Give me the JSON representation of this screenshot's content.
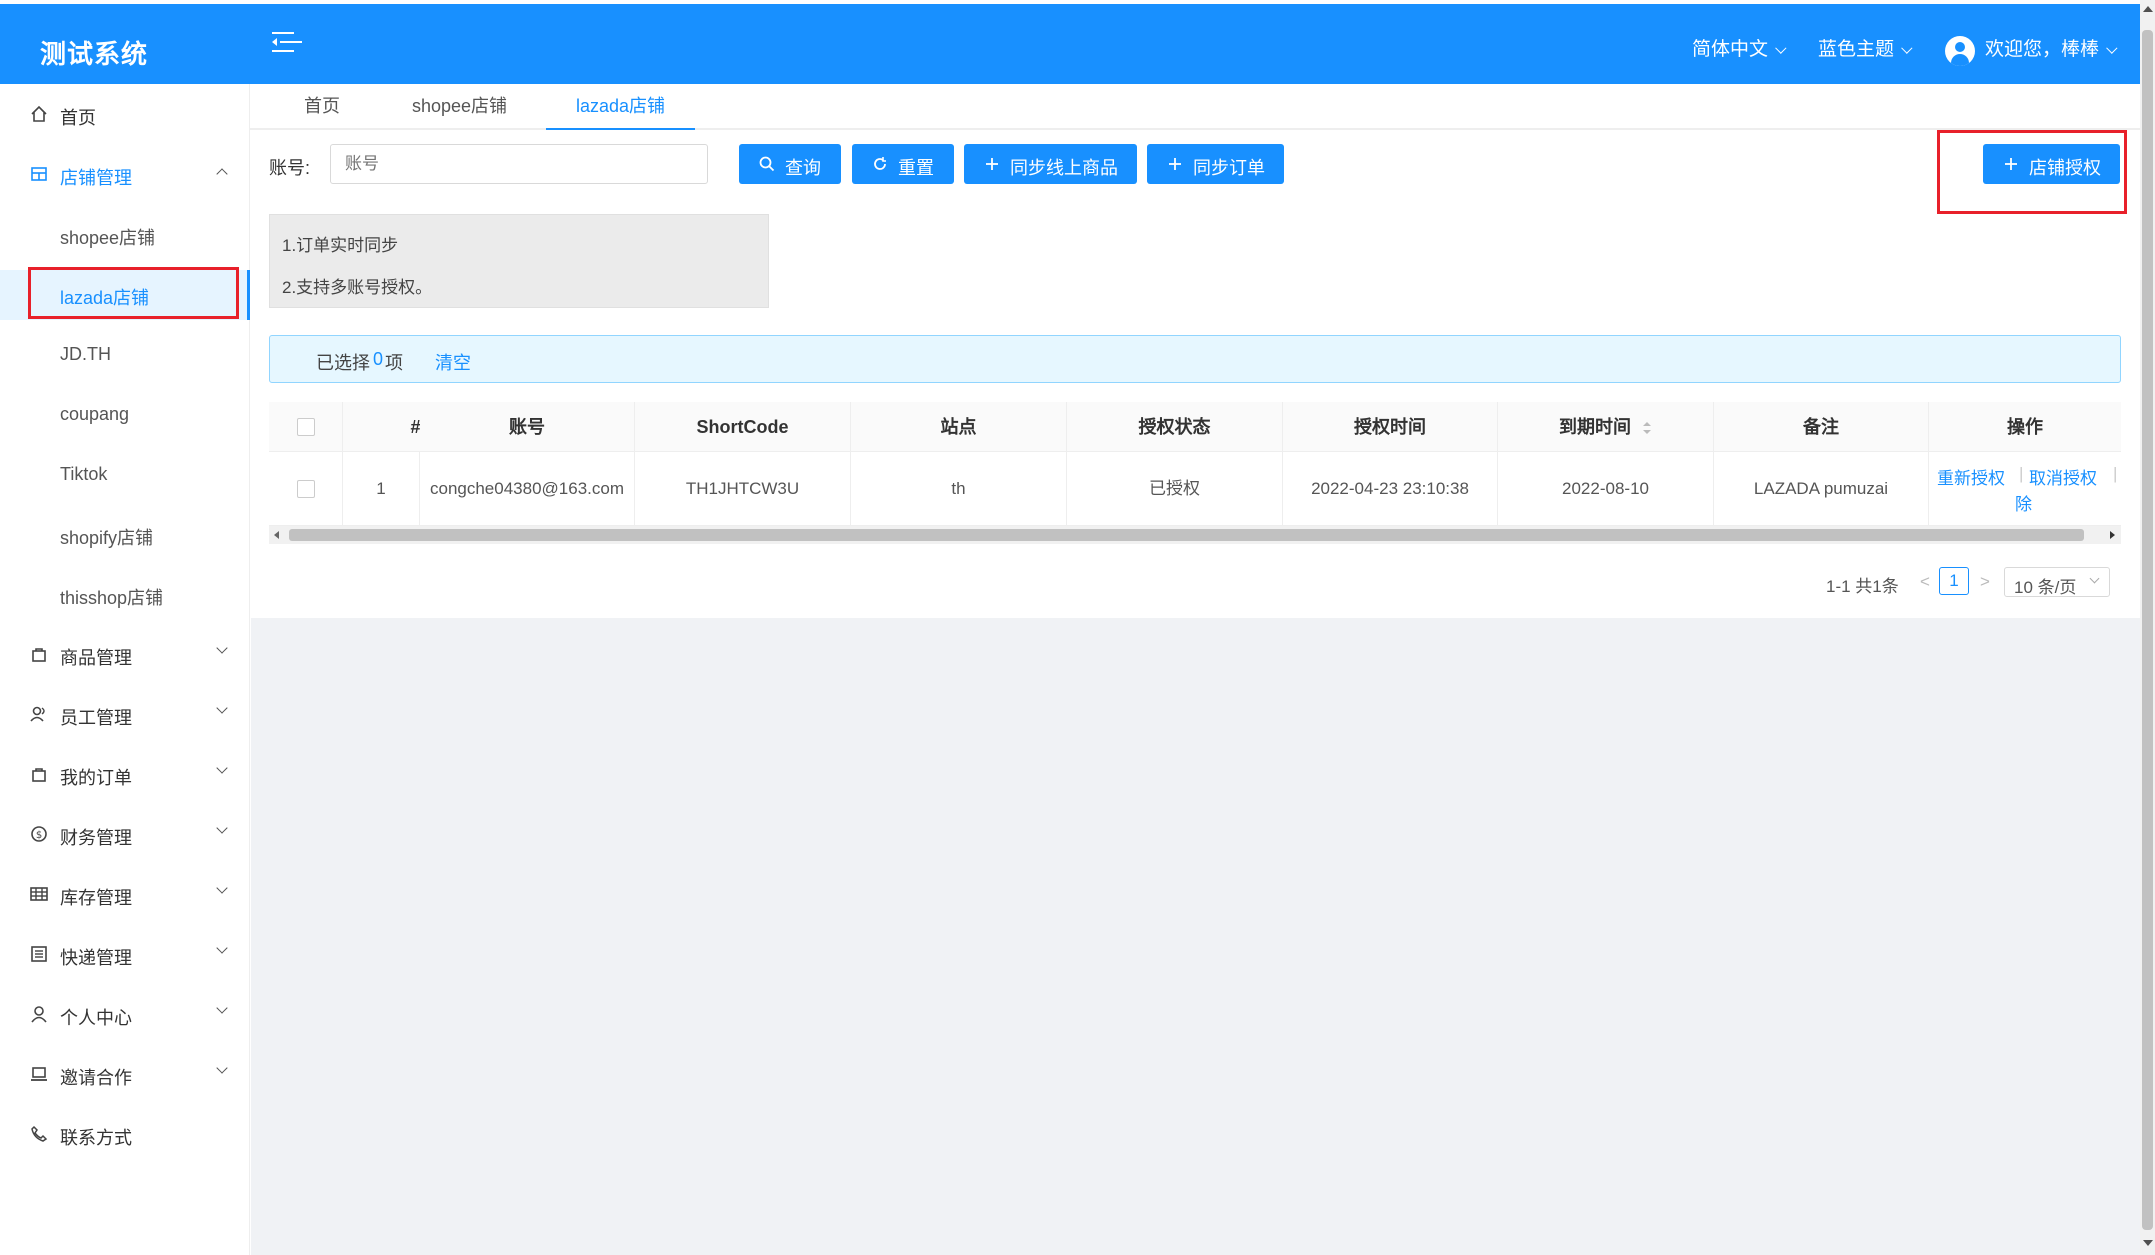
{
  "app": {
    "title": "测试系统"
  },
  "header": {
    "language": "简体中文",
    "theme": "蓝色主题",
    "welcome": "欢迎您，棒棒"
  },
  "sidebar": {
    "items": [
      {
        "label": "首页",
        "icon": "home-icon"
      },
      {
        "label": "店铺管理",
        "icon": "store-icon"
      },
      {
        "label": "商品管理",
        "icon": "bag-icon"
      },
      {
        "label": "员工管理",
        "icon": "users-icon"
      },
      {
        "label": "我的订单",
        "icon": "bag-icon"
      },
      {
        "label": "财务管理",
        "icon": "dollar-icon"
      },
      {
        "label": "库存管理",
        "icon": "table-icon"
      },
      {
        "label": "快递管理",
        "icon": "list-icon"
      },
      {
        "label": "个人中心",
        "icon": "user-icon"
      },
      {
        "label": "邀请合作",
        "icon": "laptop-icon"
      },
      {
        "label": "联系方式",
        "icon": "phone-icon"
      }
    ],
    "sub_items": [
      "shopee店铺",
      "lazada店铺",
      "JD.TH",
      "coupang",
      "Tiktok",
      "shopify店铺",
      "thisshop店铺"
    ]
  },
  "tabs": [
    "首页",
    "shopee店铺",
    "lazada店铺"
  ],
  "search": {
    "label": "账号:",
    "placeholder": "账号"
  },
  "toolbar": {
    "query": "查询",
    "reset": "重置",
    "sync_products": "同步线上商品",
    "sync_orders": "同步订单",
    "authorize": "店铺授权"
  },
  "notice": {
    "line1": "1.订单实时同步",
    "line2": "2.支持多账号授权。"
  },
  "selection": {
    "prefix": "已选择",
    "count": "0",
    "suffix": "项",
    "clear": "清空"
  },
  "table": {
    "headers": [
      "#",
      "账号",
      "ShortCode",
      "站点",
      "授权状态",
      "授权时间",
      "到期时间",
      "备注",
      "操作"
    ],
    "rows": [
      {
        "index": "1",
        "account": "congche04380@163.com",
        "shortcode": "TH1JHTCW3U",
        "site": "th",
        "status": "已授权",
        "auth_time": "2022-04-23 23:10:38",
        "expire_time": "2022-08-10",
        "remark": "LAZADA pumuzai",
        "actions": {
          "reauth": "重新授权",
          "cancel": "取消授权",
          "delete_tail": "除"
        }
      }
    ]
  },
  "pagination": {
    "summary": "1-1 共1条",
    "current": "1",
    "page_size": "10 条/页"
  },
  "colors": {
    "primary": "#1890ff",
    "highlight": "#e8202a"
  }
}
